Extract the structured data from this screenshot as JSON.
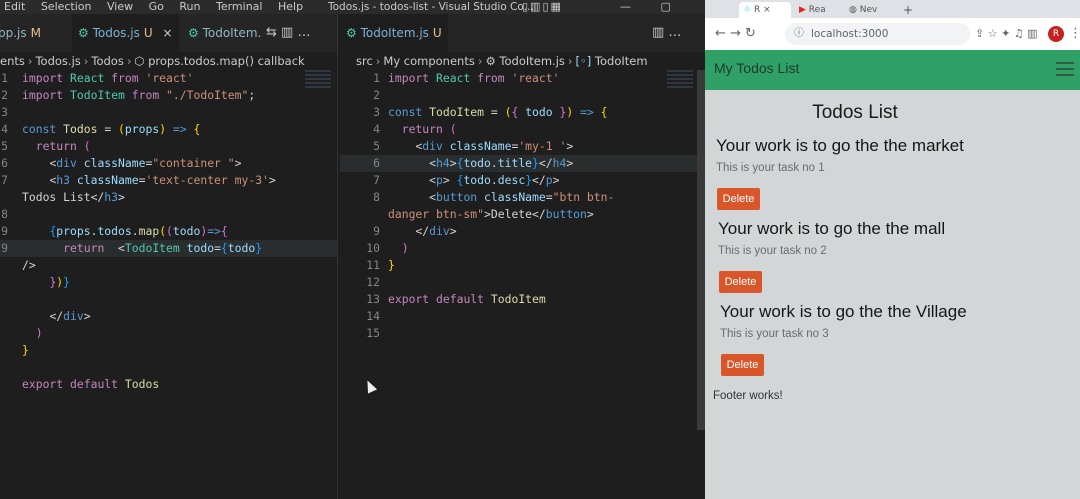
{
  "vscode": {
    "menu": [
      "Edit",
      "Selection",
      "View",
      "Go",
      "Run",
      "Terminal",
      "Help"
    ],
    "window_title": "Todos.js - todos-list - Visual Studio Co...",
    "layout_icons": "▯▥▯▦",
    "window_controls": [
      "—",
      "▢"
    ],
    "left": {
      "tabs": [
        {
          "label": "pp.js",
          "status": "M"
        },
        {
          "label": "Todos.js",
          "status": "U"
        },
        {
          "label": "TodoItem.",
          "status": ""
        }
      ],
      "tab_icons": "⇆ ▥ …",
      "breadcrumb": [
        "ents",
        "Todos.js",
        "Todos",
        "props.todos.map() callback"
      ],
      "lines": [
        {
          "n": "1",
          "html": "<span class=\"kw\">import</span> <span class=\"cmp\">React</span> <span class=\"kw\">from</span> <span class=\"str\">'react'</span>"
        },
        {
          "n": "2",
          "html": "<span class=\"kw\">import</span> <span class=\"cmp\">TodoItem</span> <span class=\"kw\">from</span> <span class=\"str\">\"./TodoItem\"</span><span class=\"plain\">;</span>"
        },
        {
          "n": "3",
          "html": ""
        },
        {
          "n": "4",
          "html": "<span class=\"kb\">const</span> <span class=\"fn\">Todos</span> <span class=\"plain\">=</span> <span class=\"brk\">(</span><span class=\"var\">props</span><span class=\"brk\">)</span> <span class=\"kb\">=&gt;</span> <span class=\"brk\">{</span>"
        },
        {
          "n": "5",
          "html": "  <span class=\"kw\">return</span> <span class=\"brk2\">(</span>"
        },
        {
          "n": "6",
          "html": "    <span class=\"plain\">&lt;</span><span class=\"tag\">div</span> <span class=\"var\">className</span><span class=\"plain\">=</span><span class=\"str\">\"container \"</span><span class=\"plain\">&gt;</span>"
        },
        {
          "n": "7",
          "html": "    <span class=\"plain\">&lt;</span><span class=\"tag\">h3</span> <span class=\"var\">className</span><span class=\"plain\">=</span><span class=\"str\">'text-center my-3'</span><span class=\"plain\">&gt;</span>"
        },
        {
          "n": "",
          "html": "<span class=\"plain\">Todos List&lt;/</span><span class=\"tag\">h3</span><span class=\"plain\">&gt;</span>"
        },
        {
          "n": "8",
          "html": ""
        },
        {
          "n": "9",
          "html": "    <span class=\"brk3\">{</span><span class=\"var\">props</span><span class=\"plain\">.</span><span class=\"var\">todos</span><span class=\"plain\">.</span><span class=\"fn\">map</span><span class=\"brk\">(</span><span class=\"brk2\">(</span><span class=\"var\">todo</span><span class=\"brk2\">)</span><span class=\"kb\">=&gt;</span><span class=\"brk2\">{</span>"
        },
        {
          "n": "9",
          "html": "      <span class=\"kw\">return</span>  <span class=\"plain\">&lt;</span><span class=\"cmp\">TodoItem</span> <span class=\"var\">todo</span><span class=\"plain\">=</span><span class=\"brk3\">{</span><span class=\"var\">todo</span><span class=\"brk3\">}</span>"
        },
        {
          "n": "",
          "html": "<span class=\"plain\">/&gt;</span>"
        },
        {
          "n": "",
          "html": "    <span class=\"brk2\">}</span><span class=\"brk\">)</span><span class=\"brk3\">}</span>"
        },
        {
          "n": "",
          "html": ""
        },
        {
          "n": "",
          "html": "    <span class=\"plain\">&lt;/</span><span class=\"tag\">div</span><span class=\"plain\">&gt;</span>"
        },
        {
          "n": "",
          "html": "  <span class=\"brk2\">)</span>"
        },
        {
          "n": "",
          "html": "<span class=\"brk\">}</span>"
        },
        {
          "n": "",
          "html": ""
        },
        {
          "n": "",
          "html": "<span class=\"kw\">export</span> <span class=\"kw\">default</span> <span class=\"fn\">Todos</span>"
        }
      ]
    },
    "right": {
      "tab": {
        "label": "TodoItem.js",
        "status": "U"
      },
      "tab_icons": "▥ …",
      "breadcrumb": [
        "src",
        "My components",
        "TodoItem.js",
        "TodoItem"
      ],
      "lines": [
        {
          "n": "1",
          "html": "<span class=\"kw\">import</span> <span class=\"cmp\">React</span> <span class=\"kw\">from</span> <span class=\"str\">'react'</span>"
        },
        {
          "n": "2",
          "html": ""
        },
        {
          "n": "3",
          "html": "<span class=\"kb\">const</span> <span class=\"fn\">TodoItem</span> <span class=\"plain\">=</span> <span class=\"brk\">(</span><span class=\"brk2\">{</span> <span class=\"var\">todo</span> <span class=\"brk2\">}</span><span class=\"brk\">)</span> <span class=\"kb\">=&gt;</span> <span class=\"brk\">{</span>"
        },
        {
          "n": "4",
          "html": "  <span class=\"kw\">return</span> <span class=\"brk2\">(</span>"
        },
        {
          "n": "5",
          "html": "    <span class=\"plain\">&lt;</span><span class=\"tag\">div</span> <span class=\"var\">className</span><span class=\"plain\">=</span><span class=\"str\">'my-1 '</span><span class=\"plain\">&gt;</span>"
        },
        {
          "n": "6",
          "html": "      <span class=\"plain\">&lt;</span><span class=\"tag\">h4</span><span class=\"plain\">&gt;</span><span class=\"brk3\">{</span><span class=\"var\">todo</span><span class=\"plain\">.</span><span class=\"var\">title</span><span class=\"brk3\">}</span><span class=\"plain\">&lt;/</span><span class=\"tag\">h4</span><span class=\"plain\">&gt;</span>"
        },
        {
          "n": "7",
          "html": "      <span class=\"plain\">&lt;</span><span class=\"tag\">p</span><span class=\"plain\">&gt;</span> <span class=\"brk3\">{</span><span class=\"var\">todo</span><span class=\"plain\">.</span><span class=\"var\">desc</span><span class=\"brk3\">}</span><span class=\"plain\">&lt;/</span><span class=\"tag\">p</span><span class=\"plain\">&gt;</span>"
        },
        {
          "n": "8",
          "html": "      <span class=\"plain\">&lt;</span><span class=\"tag\">button</span> <span class=\"var\">className</span><span class=\"plain\">=</span><span class=\"str\">\"btn btn-</span>"
        },
        {
          "n": "",
          "html": "<span class=\"str\">danger btn-sm\"</span><span class=\"plain\">&gt;Delete&lt;/</span><span class=\"tag\">button</span><span class=\"plain\">&gt;</span>"
        },
        {
          "n": "9",
          "html": "    <span class=\"plain\">&lt;/</span><span class=\"tag\">div</span><span class=\"plain\">&gt;</span>"
        },
        {
          "n": "10",
          "html": "  <span class=\"brk2\">)</span>"
        },
        {
          "n": "11",
          "html": "<span class=\"brk\">}</span>"
        },
        {
          "n": "12",
          "html": ""
        },
        {
          "n": "13",
          "html": "<span class=\"kw\">export</span> <span class=\"kw\">default</span> <span class=\"fn\">TodoItem</span>"
        },
        {
          "n": "14",
          "html": ""
        },
        {
          "n": "15",
          "html": ""
        }
      ]
    }
  },
  "browser": {
    "tabs": [
      "R",
      "Rea",
      "Nev",
      "+"
    ],
    "url": "localhost:3000",
    "nav_icons": "← → ↻",
    "toolbar_icons": "⇪ ☆ ✦ ♫ ▥",
    "profile": "R",
    "app": {
      "brand": "My Todos List",
      "heading": "Todos List",
      "todos": [
        {
          "title": "Your work is to go the the market",
          "desc": "This is your task no 1",
          "button": "Delete"
        },
        {
          "title": "Your work is to go the the mall",
          "desc": "This is your task no 2",
          "button": "Delete"
        },
        {
          "title": "Your work is to go the the Village",
          "desc": "This is your task no 3",
          "button": "Delete"
        }
      ],
      "footer": "Footer works!"
    }
  }
}
